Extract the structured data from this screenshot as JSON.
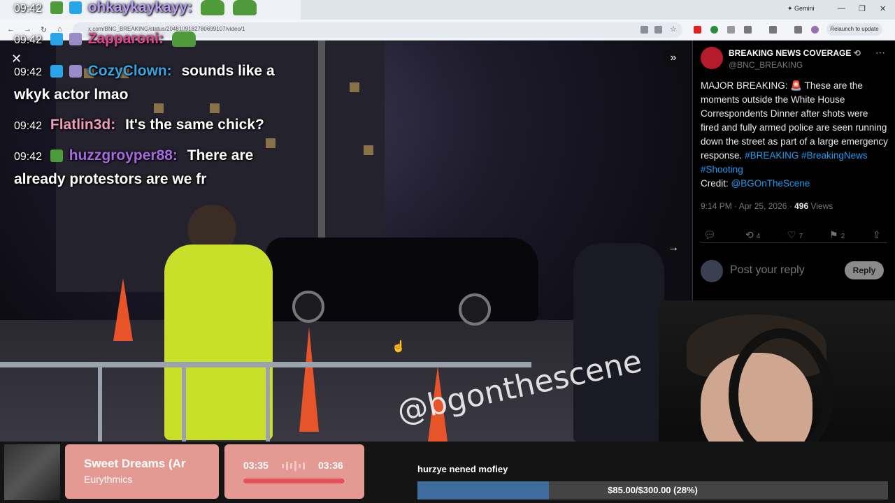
{
  "browser": {
    "url": "x.com/BNC_BREAKING/status/2048109182780699107/video/1",
    "gemini_label": "Gemini",
    "relaunch_label": "Relaunch to update"
  },
  "chat": [
    {
      "time": "09:42",
      "user": "ohkaykaykayy:",
      "user_color": "#b79cf0",
      "message": ""
    },
    {
      "time": "09:42",
      "user": "Zapparoni:",
      "user_color": "#e0468f",
      "message": ""
    },
    {
      "time": "09:42",
      "user": "CozyClown:",
      "user_color": "#3aa4e0",
      "message": "sounds like a",
      "message2": "wkyk actor lmao"
    },
    {
      "time": "09:42",
      "user": "Flatlin3d:",
      "user_color": "#ef9cbc",
      "message": "It's the same chick?"
    },
    {
      "time": "09:42",
      "user": "huzzgroyper88:",
      "user_color": "#a66ae0",
      "message": "There are",
      "message2": "already protestors are we fr"
    }
  ],
  "video": {
    "watermark": "@bgonthescene",
    "controls": {
      "close": "✕",
      "expand": "»",
      "next": "→"
    }
  },
  "post": {
    "account_name": "BREAKING NEWS COVERAGE",
    "handle": "@BNC_BREAKING",
    "body_text": "MAJOR BREAKING: 🚨 These are the moments outside the White House Correspondents Dinner after shots were fired and fully armed police are seen running down the street as part of a large emergency response.",
    "hashtags": [
      "#BREAKING",
      "#BreakingNews",
      "#Shooting"
    ],
    "credit_label": "Credit:",
    "credit_handle": "@BGOnTheScene",
    "timestamp": "9:14 PM · Apr 25, 2026",
    "views_count": "496",
    "views_label": "Views",
    "retweets": "4",
    "likes": "7",
    "bookmarks": "2",
    "reply_placeholder": "Post your reply",
    "reply_button": "Reply"
  },
  "music": {
    "title": "Sweet Dreams (Ar",
    "artist": "Eurythmics",
    "current_time": "03:35",
    "total_time": "03:36",
    "progress": 0.99
  },
  "goal": {
    "label": "hurzye nened mofiey",
    "text": "$85.00/$300.00 (28%)",
    "progress": 0.28
  }
}
